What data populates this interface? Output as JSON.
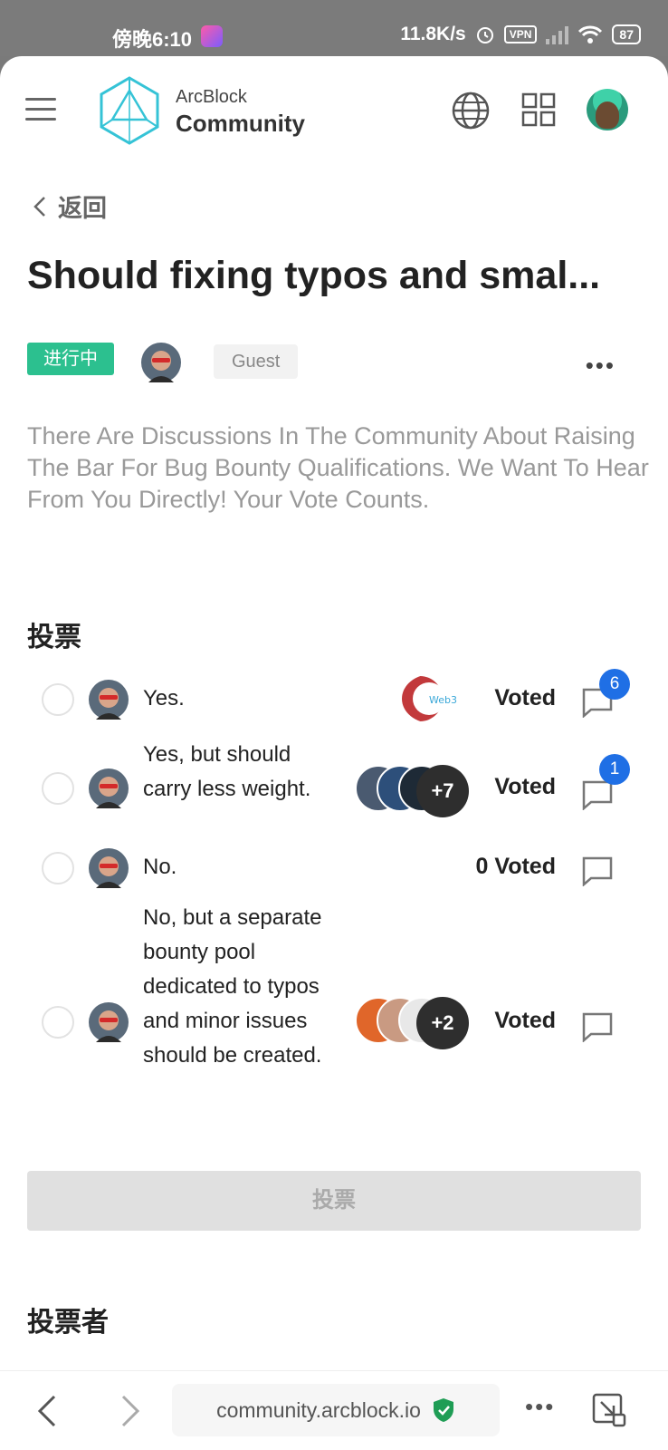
{
  "status_bar": {
    "time": "傍晚6:10",
    "net_speed": "11.8K/s",
    "vpn": "VPN",
    "battery": "87"
  },
  "header": {
    "brand_top": "ArcBlock",
    "brand_bottom": "Community",
    "menu_icon": "hamburger-icon",
    "globe_icon": "globe-icon",
    "apps_icon": "grid-icon"
  },
  "back_label": "返回",
  "post": {
    "title": "Should fixing typos and smal...",
    "status": "进行中",
    "tag": "Guest",
    "description": "There Are Discussions In The Community About Raising The Bar For Bug Bounty Qualifications. We Want To Hear From You Directly! Your Vote Counts."
  },
  "poll": {
    "heading": "投票",
    "options": [
      {
        "label": "Yes.",
        "voted": "Voted",
        "more": "",
        "comments": "6"
      },
      {
        "label": "Yes, but should carry less weight.",
        "voted": "Voted",
        "more": "+7",
        "comments": "1"
      },
      {
        "label": "No.",
        "voted": "0 Voted",
        "more": "",
        "comments": ""
      },
      {
        "label": "No, but a separate bounty pool dedicated to typos and minor issues should be created.",
        "voted": "Voted",
        "more": "+2",
        "comments": ""
      }
    ],
    "voter_badge_text": "Web3",
    "vote_button": "投票"
  },
  "voters_heading": "投票者",
  "browser": {
    "url": "community.arcblock.io"
  },
  "colors": {
    "status_green": "#2cc08f",
    "badge_blue": "#1f6fe5",
    "logo_cyan": "#35c3d6"
  }
}
